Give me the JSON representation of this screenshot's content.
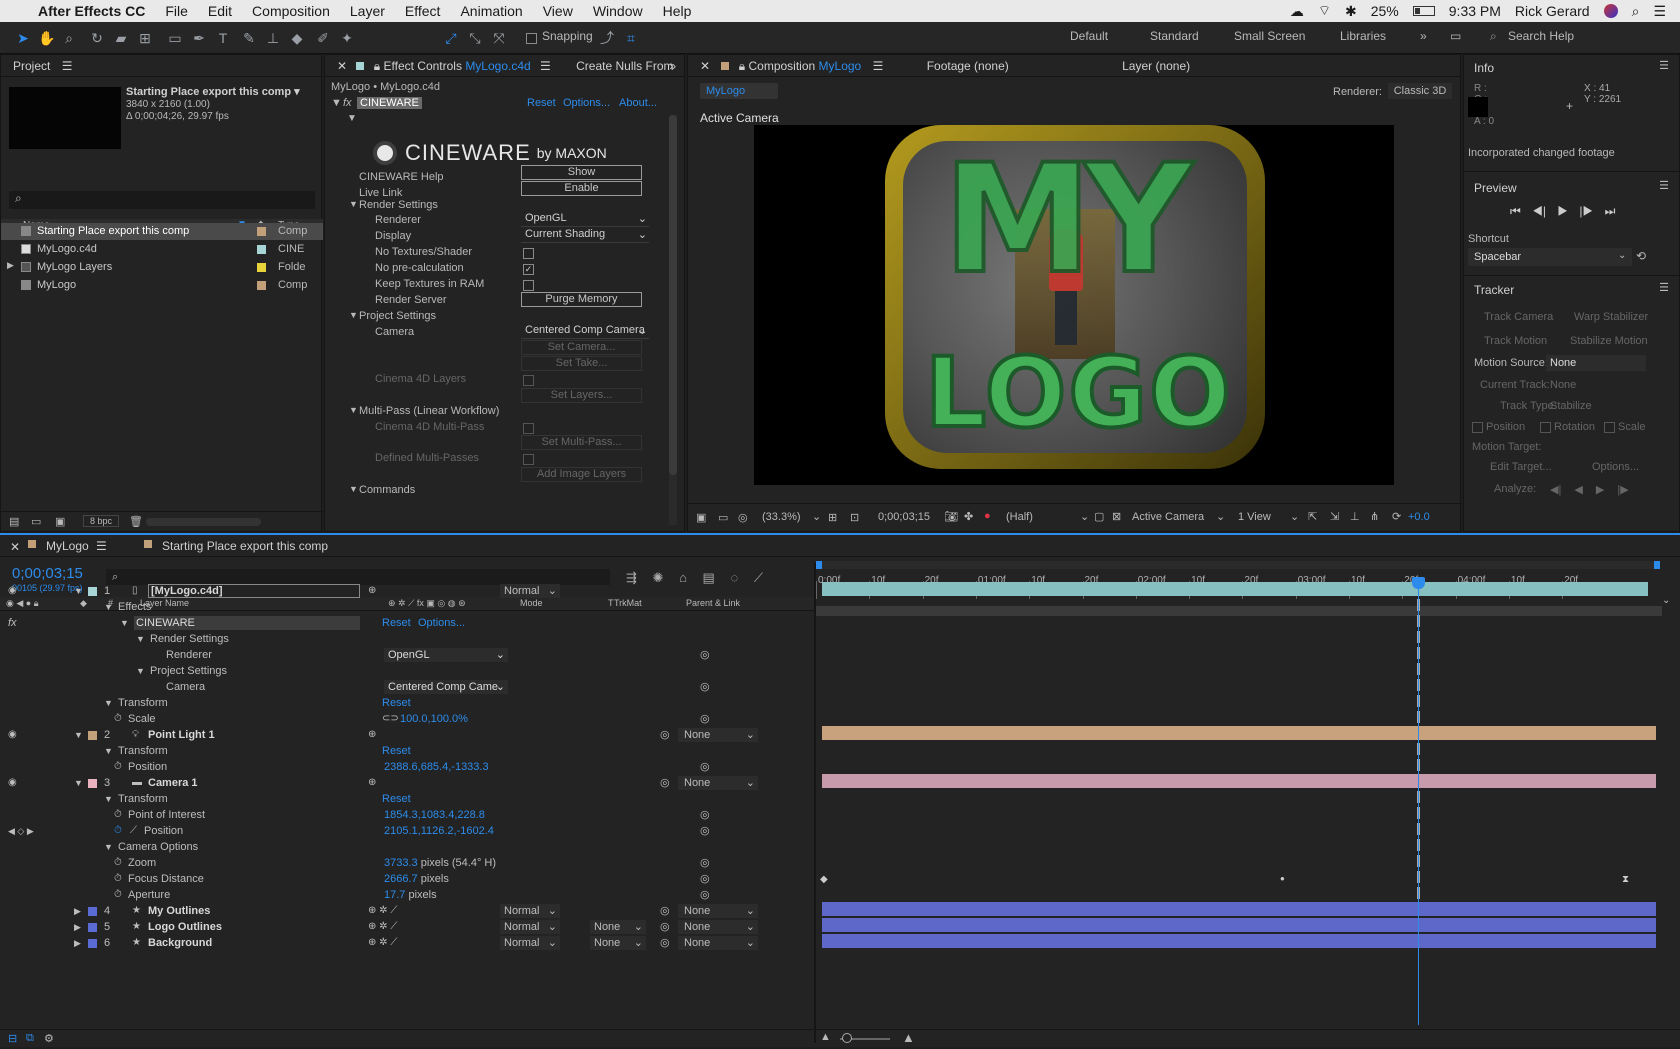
{
  "menubar": {
    "app": "After Effects CC",
    "items": [
      "File",
      "Edit",
      "Composition",
      "Layer",
      "Effect",
      "Animation",
      "View",
      "Window",
      "Help"
    ],
    "battery": "25%",
    "time": "9:33 PM",
    "user": "Rick Gerard"
  },
  "toolbar": {
    "snapping": "Snapping",
    "workspaces": [
      "Default",
      "Standard",
      "Small Screen",
      "Libraries"
    ],
    "search_placeholder": "Search Help"
  },
  "project": {
    "title": "Project",
    "comp_name": "Starting Place export this comp ▾",
    "comp_res": "3840 x 2160 (1.00)",
    "comp_dur": "Δ 0;00;04;26, 29.97 fps",
    "col_name": "Name",
    "col_type": "Type",
    "items": [
      {
        "name": "Starting Place export this comp",
        "type": "Comp",
        "color": "#c2a07a"
      },
      {
        "name": "MyLogo.c4d",
        "type": "CINE",
        "color": "#a7d4d4"
      },
      {
        "name": "MyLogo Layers",
        "type": "Folde",
        "color": "#e8d33a"
      },
      {
        "name": "MyLogo",
        "type": "Comp",
        "color": "#c2a07a"
      }
    ],
    "bpc": "8 bpc"
  },
  "effects": {
    "tab": "Effect Controls",
    "tab_comp": "MyLogo.c4d",
    "tab2": "Create Nulls From",
    "path": "MyLogo • MyLogo.c4d",
    "fx_name": "CINEWARE",
    "reset": "Reset",
    "options": "Options...",
    "about": "About...",
    "logo_text": "CINEWARE",
    "logo_by": "by MAXON",
    "rows": [
      {
        "label": "CINEWARE Help",
        "btn": "Show"
      },
      {
        "label": "Live Link",
        "btn": "Enable"
      }
    ],
    "render_settings": "Render Settings",
    "renderer_label": "Renderer",
    "renderer_val": "OpenGL",
    "display_label": "Display",
    "display_val": "Current Shading",
    "no_tex": "No Textures/Shader",
    "no_pre": "No pre-calculation",
    "keep_tex": "Keep Textures in RAM",
    "render_server": "Render Server",
    "purge": "Purge Memory",
    "project_settings": "Project Settings",
    "camera_label": "Camera",
    "camera_val": "Centered Comp Camera",
    "set_camera": "Set Camera...",
    "set_take": "Set Take...",
    "c4d_layers": "Cinema 4D Layers",
    "set_layers": "Set Layers...",
    "multipass": "Multi-Pass (Linear Workflow)",
    "c4d_multi": "Cinema 4D Multi-Pass",
    "set_multi": "Set Multi-Pass...",
    "defined_multi": "Defined Multi-Passes",
    "add_image": "Add Image Layers",
    "commands": "Commands"
  },
  "comp": {
    "tab": "Composition",
    "tab_comp": "MyLogo",
    "footage": "Footage (none)",
    "layer": "Layer (none)",
    "active_tab": "MyLogo",
    "renderer_label": "Renderer:",
    "renderer_val": "Classic 3D",
    "active_camera": "Active Camera",
    "logo_top": "MY",
    "logo_bottom": "LOGO",
    "zoom": "(33.3%)",
    "timecode": "0;00;03;15",
    "res": "(Half)",
    "view": "Active Camera",
    "views": "1 View",
    "exposure": "+0.0"
  },
  "info": {
    "title": "Info",
    "r": "R :",
    "g": "G :",
    "b": "B :",
    "a": "A : 0",
    "x": "X : 41",
    "y": "Y : 2261",
    "msg": "Incorporated changed footage"
  },
  "preview": {
    "title": "Preview",
    "shortcut_label": "Shortcut",
    "shortcut_val": "Spacebar"
  },
  "tracker": {
    "title": "Tracker",
    "track_camera": "Track Camera",
    "warp": "Warp Stabilizer",
    "track_motion": "Track Motion",
    "stabilize": "Stabilize Motion",
    "source_label": "Motion Source:",
    "source_val": "None",
    "current_label": "Current Track:",
    "current_val": "None",
    "type_label": "Track Type:",
    "type_val": "Stabilize",
    "position": "Position",
    "rotation": "Rotation",
    "scale": "Scale",
    "target": "Motion Target:",
    "edit_target": "Edit Target...",
    "options": "Options...",
    "analyze": "Analyze:"
  },
  "timeline": {
    "tab": "MyLogo",
    "tab2": "Starting Place export this comp",
    "timecode": "0;00;03;15",
    "frames": "00105 (29.97 fps)",
    "col_layer": "Layer Name",
    "col_mode": "Mode",
    "col_t": "T",
    "col_trkmat": "TrkMat",
    "col_parent": "Parent & Link",
    "ruler": [
      "0:00f",
      "10f",
      "20f",
      "01:00f",
      "10f",
      "20f",
      "02:00f",
      "10f",
      "20f",
      "03:00f",
      "10f",
      "20f",
      "04:00f",
      "10f",
      "20f"
    ],
    "rows": [
      {
        "t": "layer",
        "num": "1",
        "name": "[MyLogo.c4d]",
        "color": "#a7d4d4",
        "mode": "Normal",
        "eye": true
      },
      {
        "t": "prop",
        "ind": 1,
        "name": "Effects"
      },
      {
        "t": "fx",
        "ind": 2,
        "name": "CINEWARE",
        "reset": "Reset",
        "options": "Options..."
      },
      {
        "t": "prop",
        "ind": 3,
        "name": "Render Settings"
      },
      {
        "t": "propv",
        "ind": 4,
        "name": "Renderer",
        "dd": "OpenGL"
      },
      {
        "t": "prop",
        "ind": 3,
        "name": "Project Settings"
      },
      {
        "t": "propv",
        "ind": 4,
        "name": "Camera",
        "dd": "Centered Comp Came"
      },
      {
        "t": "prop",
        "ind": 1,
        "name": "Transform",
        "reset": "Reset"
      },
      {
        "t": "val",
        "ind": 2,
        "name": "Scale",
        "val": "100.0,100.0%"
      },
      {
        "t": "layer",
        "num": "2",
        "name": "Point Light 1",
        "color": "#c2a07a",
        "parent": "None",
        "eye": true
      },
      {
        "t": "prop",
        "ind": 1,
        "name": "Transform",
        "reset": "Reset"
      },
      {
        "t": "val",
        "ind": 2,
        "name": "Position",
        "val": "2388.6,685.4,-1333.3"
      },
      {
        "t": "layer",
        "num": "3",
        "name": "Camera 1",
        "color": "#e9b3c0",
        "parent": "None",
        "eye": true
      },
      {
        "t": "prop",
        "ind": 1,
        "name": "Transform",
        "reset": "Reset"
      },
      {
        "t": "val",
        "ind": 2,
        "name": "Point of Interest",
        "val": "1854.3,1083.4,228.8"
      },
      {
        "t": "val",
        "ind": 2,
        "name": "Position",
        "val": "2105.1,1126.2,-1602.4",
        "key": true
      },
      {
        "t": "prop",
        "ind": 1,
        "name": "Camera Options"
      },
      {
        "t": "val",
        "ind": 2,
        "name": "Zoom",
        "val": "3733.3",
        "unit": " pixels (54.4° H)"
      },
      {
        "t": "val",
        "ind": 2,
        "name": "Focus Distance",
        "val": "2666.7",
        "unit": " pixels"
      },
      {
        "t": "val",
        "ind": 2,
        "name": "Aperture",
        "val": "17.7",
        "unit": " pixels"
      },
      {
        "t": "layer",
        "num": "4",
        "name": "My Outlines",
        "color": "#5b6bd6",
        "mode": "Normal",
        "parent": "None",
        "star": true
      },
      {
        "t": "layer",
        "num": "5",
        "name": "Logo Outlines",
        "color": "#5b6bd6",
        "mode": "Normal",
        "trk": "None",
        "parent": "None",
        "star": true
      },
      {
        "t": "layer",
        "num": "6",
        "name": "Background",
        "color": "#5b6bd6",
        "mode": "Normal",
        "trk": "None",
        "parent": "None",
        "star": true
      }
    ]
  },
  "colors": {
    "accent": "#2d8ceb",
    "playhead": "#2d8ceb",
    "layer1": "#86c0c0",
    "layer2": "#c7a27c",
    "layer3": "#c79bab",
    "shape": "#5d68c8"
  }
}
